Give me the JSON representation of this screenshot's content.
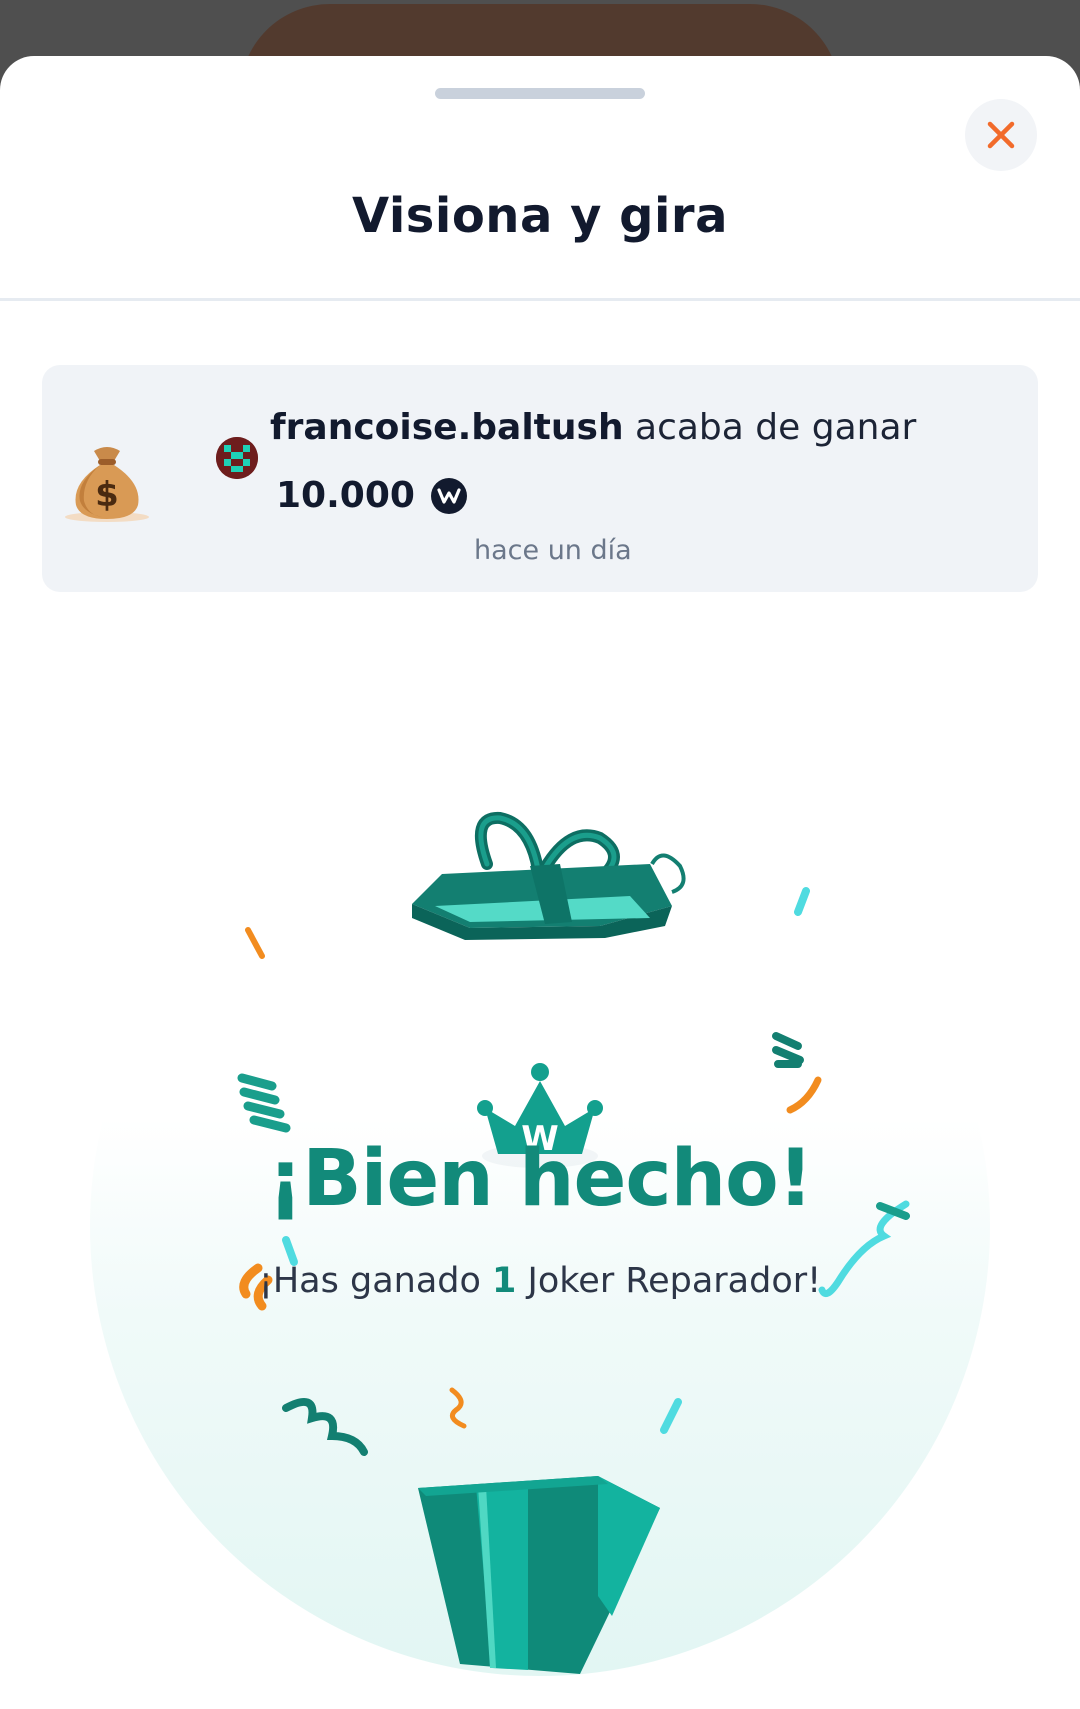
{
  "modal": {
    "title": "Visiona y gira",
    "close_icon": "close-icon"
  },
  "winner_card": {
    "icon": "money-bag-icon",
    "username": "francoise.baltush",
    "action_text": " acaba de ganar",
    "amount": "10.000",
    "coin_icon": "w-coin-icon",
    "coin_letter": "w",
    "time_ago": "hace un día"
  },
  "reward": {
    "headline": "¡Bien hecho!",
    "sub_prefix": "¡Has ganado ",
    "count": "1",
    "sub_suffix": " Joker Reparador!",
    "crown_letter": "W"
  },
  "colors": {
    "accent_teal": "#128a7a",
    "close_orange": "#f26b2b",
    "confetti_orange": "#f28c1f"
  }
}
